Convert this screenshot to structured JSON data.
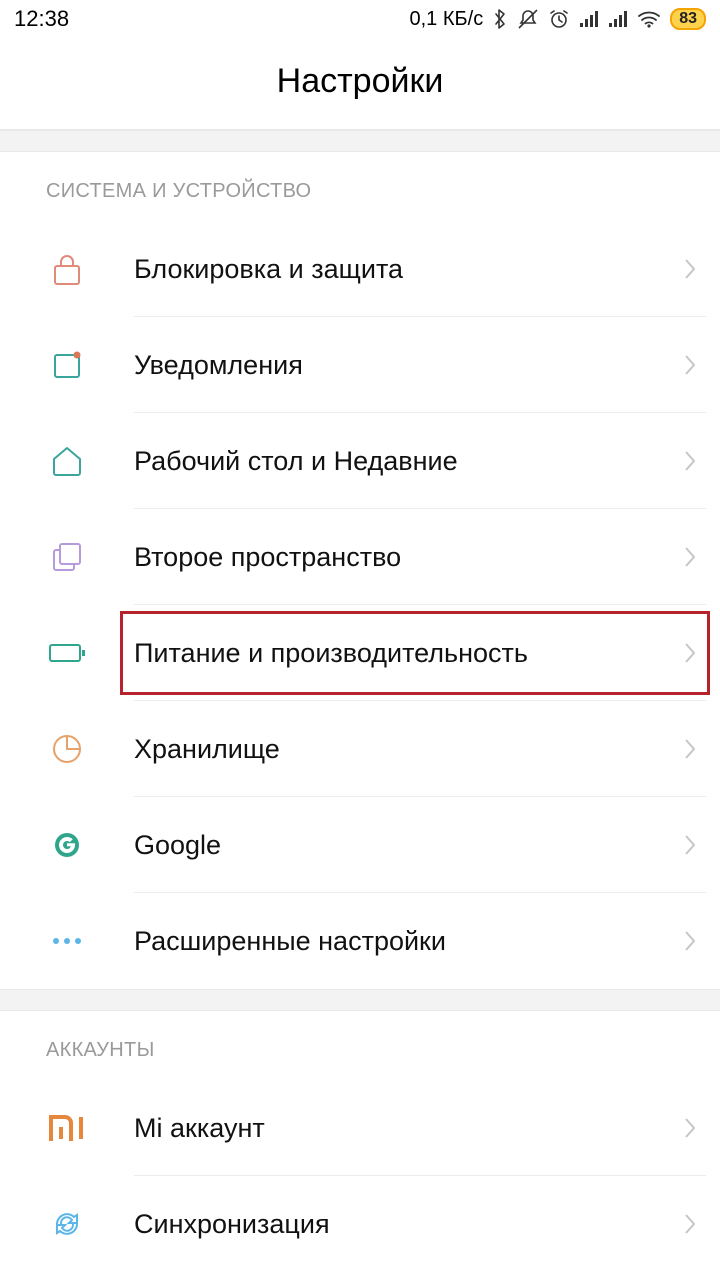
{
  "status": {
    "time": "12:38",
    "data_rate": "0,1 КБ/с",
    "battery": "83"
  },
  "header": {
    "title": "Настройки"
  },
  "sections": {
    "system": {
      "title": "СИСТЕМА И УСТРОЙСТВО",
      "items": {
        "lock": "Блокировка и защита",
        "notifications": "Уведомления",
        "home": "Рабочий стол и Недавние",
        "second_space": "Второе пространство",
        "battery": "Питание и производительность",
        "storage": "Хранилище",
        "google": "Google",
        "advanced": "Расширенные настройки"
      }
    },
    "accounts": {
      "title": "АККАУНТЫ",
      "items": {
        "mi": "Mi аккаунт",
        "sync": "Синхронизация"
      }
    }
  }
}
